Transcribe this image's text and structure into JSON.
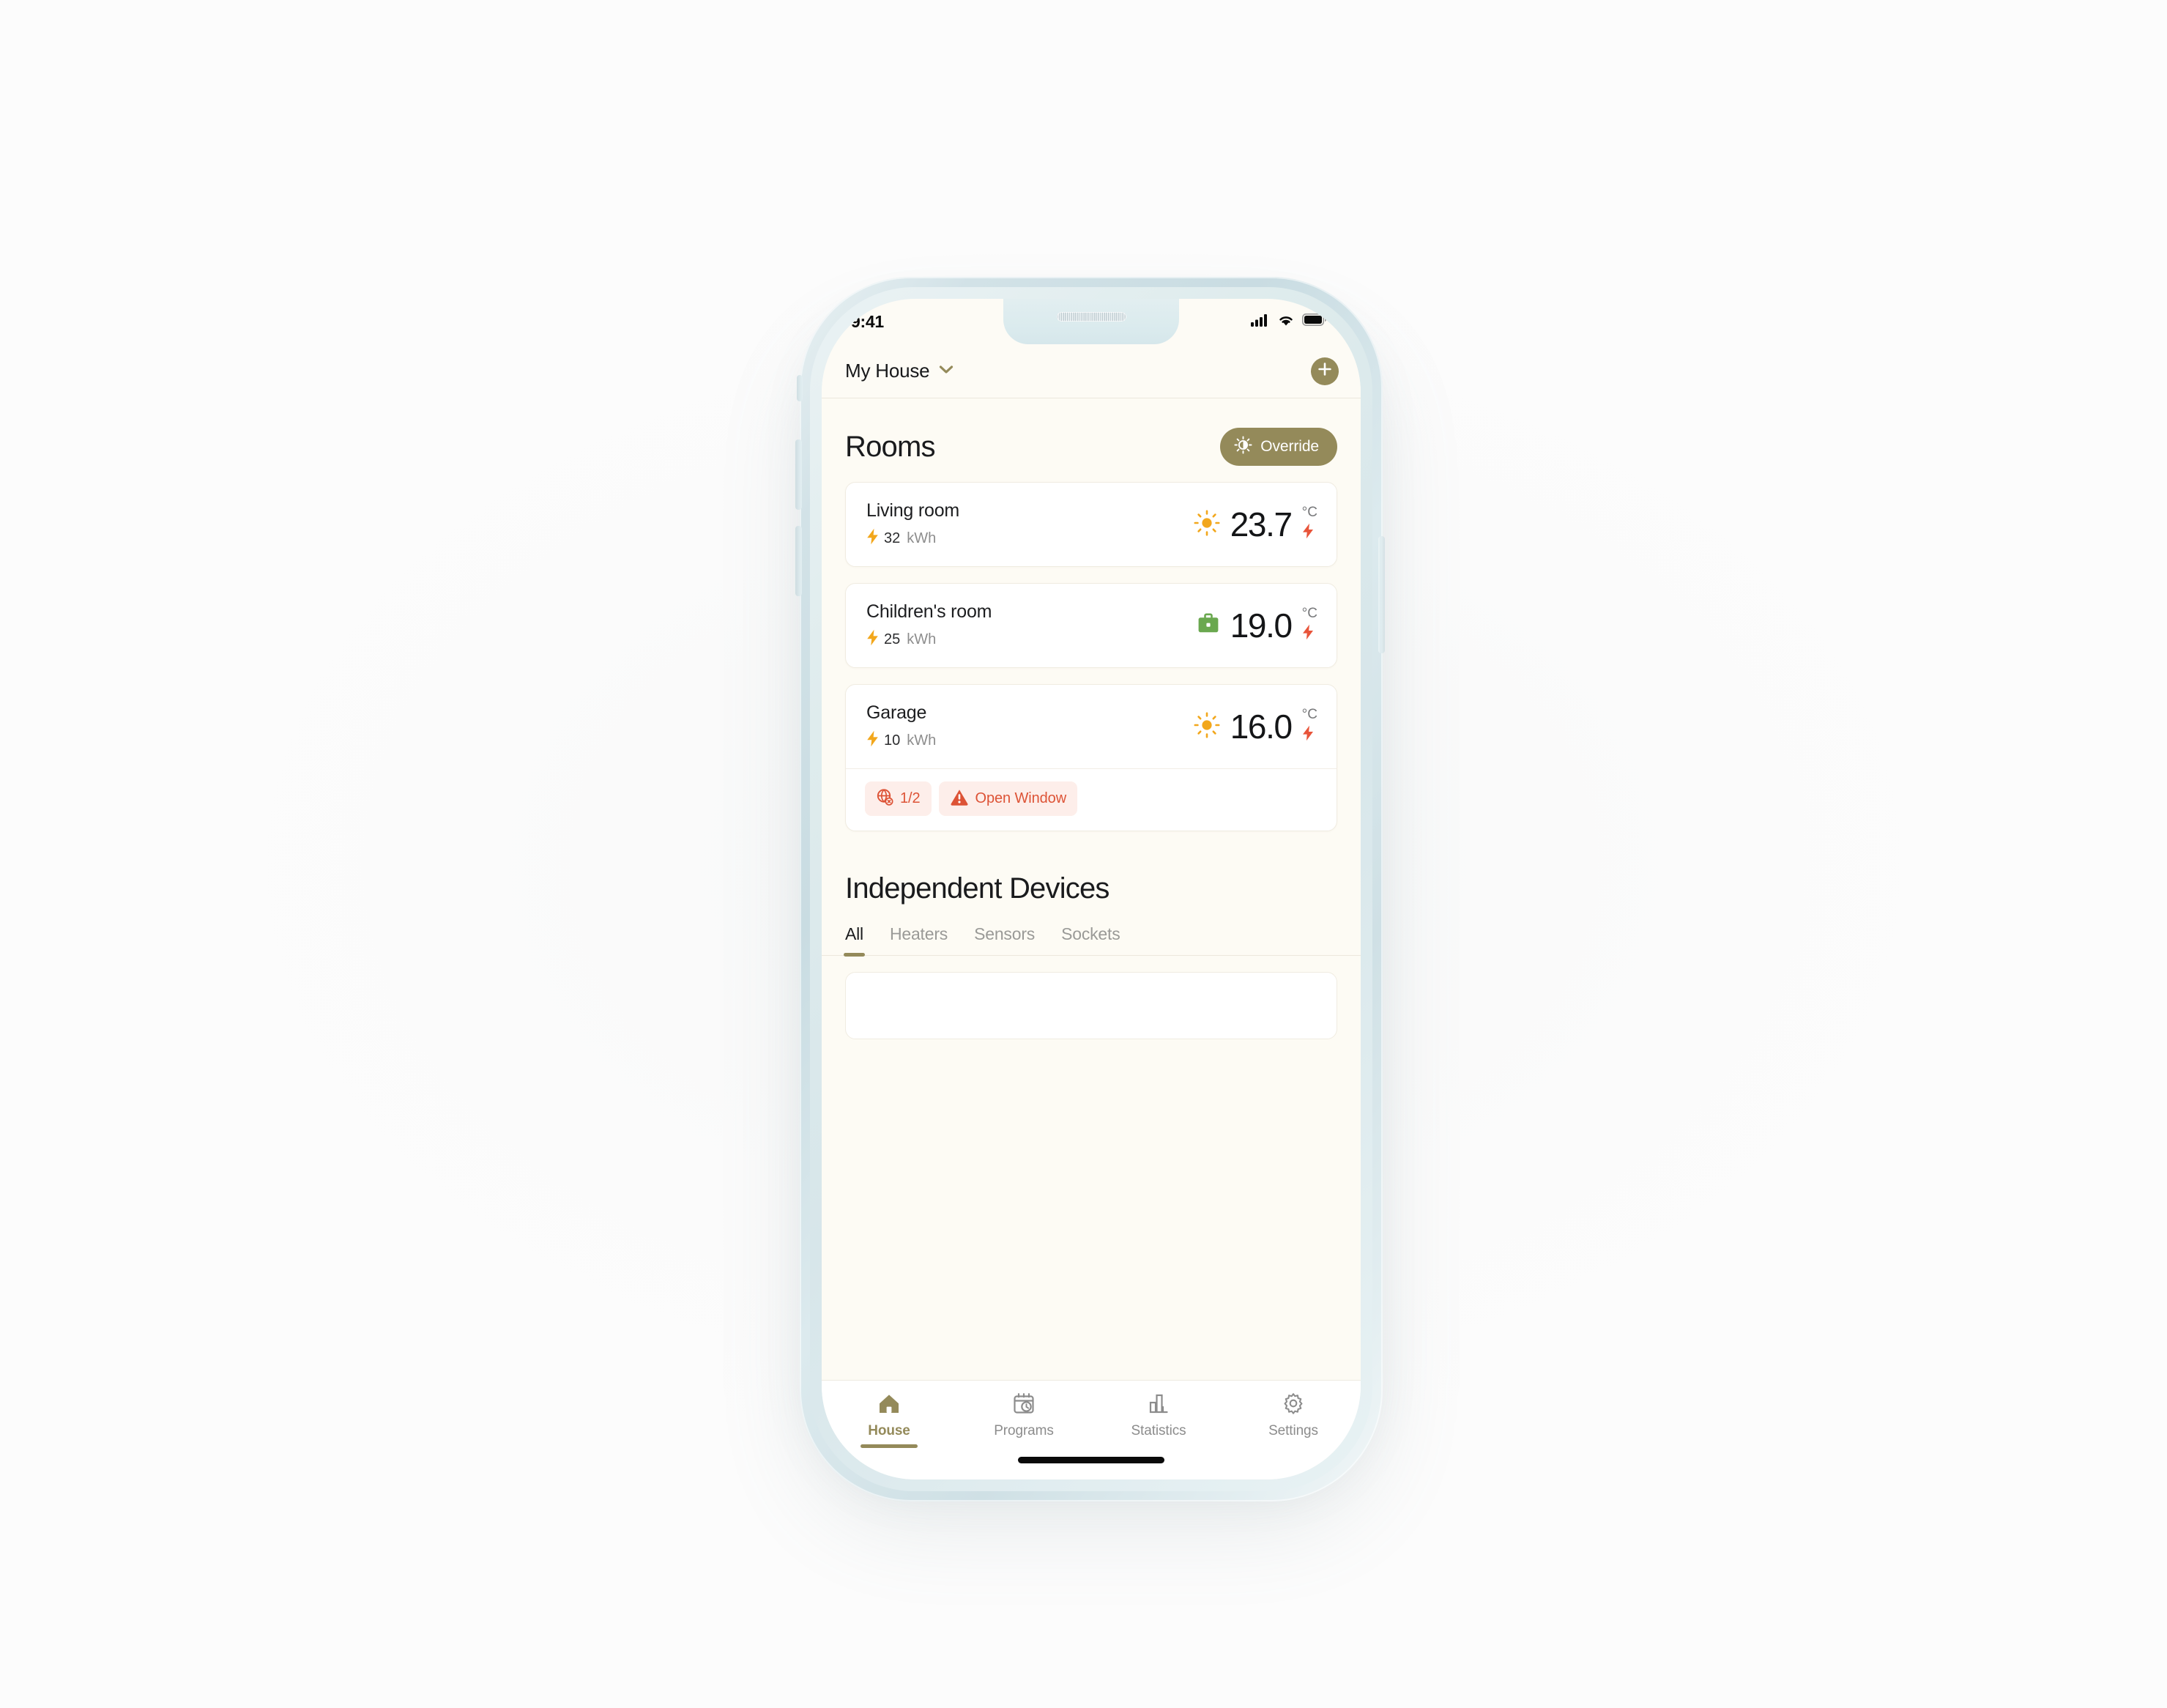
{
  "status_bar": {
    "time": "9:41",
    "icons": [
      "cellular-signal-icon",
      "wifi-icon",
      "battery-icon"
    ]
  },
  "header": {
    "house_name": "My House",
    "chevron_icon": "chevron-down-icon",
    "add_button_icon": "plus-icon"
  },
  "rooms_section": {
    "title": "Rooms",
    "override": {
      "label": "Override",
      "icon": "brightness-half-icon"
    },
    "rooms": [
      {
        "name": "Living room",
        "energy_value": "32",
        "energy_unit": "kWh",
        "energy_icon": "lightning-bolt-icon",
        "mode_icon": "sun-icon",
        "temperature": "23.7",
        "temp_unit": "°C",
        "heating_icon": "lightning-bolt-red-icon",
        "status_chips": []
      },
      {
        "name": "Children's room",
        "energy_value": "25",
        "energy_unit": "kWh",
        "energy_icon": "lightning-bolt-icon",
        "mode_icon": "briefcase-icon",
        "temperature": "19.0",
        "temp_unit": "°C",
        "heating_icon": "lightning-bolt-red-icon",
        "status_chips": []
      },
      {
        "name": "Garage",
        "energy_value": "10",
        "energy_unit": "kWh",
        "energy_icon": "lightning-bolt-icon",
        "mode_icon": "sun-icon",
        "temperature": "16.0",
        "temp_unit": "°C",
        "heating_icon": "lightning-bolt-red-icon",
        "status_chips": [
          {
            "icon": "globe-offline-icon",
            "text": "1/2"
          },
          {
            "icon": "warning-triangle-icon",
            "text": "Open Window"
          }
        ]
      }
    ]
  },
  "devices_section": {
    "title": "Independent Devices",
    "tabs": [
      {
        "label": "All",
        "active": true
      },
      {
        "label": "Heaters",
        "active": false
      },
      {
        "label": "Sensors",
        "active": false
      },
      {
        "label": "Sockets",
        "active": false
      }
    ]
  },
  "bottom_nav": [
    {
      "label": "House",
      "icon": "home-icon",
      "active": true
    },
    {
      "label": "Programs",
      "icon": "calendar-clock-icon",
      "active": false
    },
    {
      "label": "Statistics",
      "icon": "bar-chart-icon",
      "active": false
    },
    {
      "label": "Settings",
      "icon": "gear-icon",
      "active": false
    }
  ],
  "colors": {
    "accent_gold": "#948a5a",
    "alert_red": "#dd5336",
    "sun_orange": "#f2a71c",
    "briefcase_green": "#6aa84f",
    "app_background": "#fdfbf4",
    "card_background": "#ffffff",
    "chip_background": "#fdeeea"
  }
}
